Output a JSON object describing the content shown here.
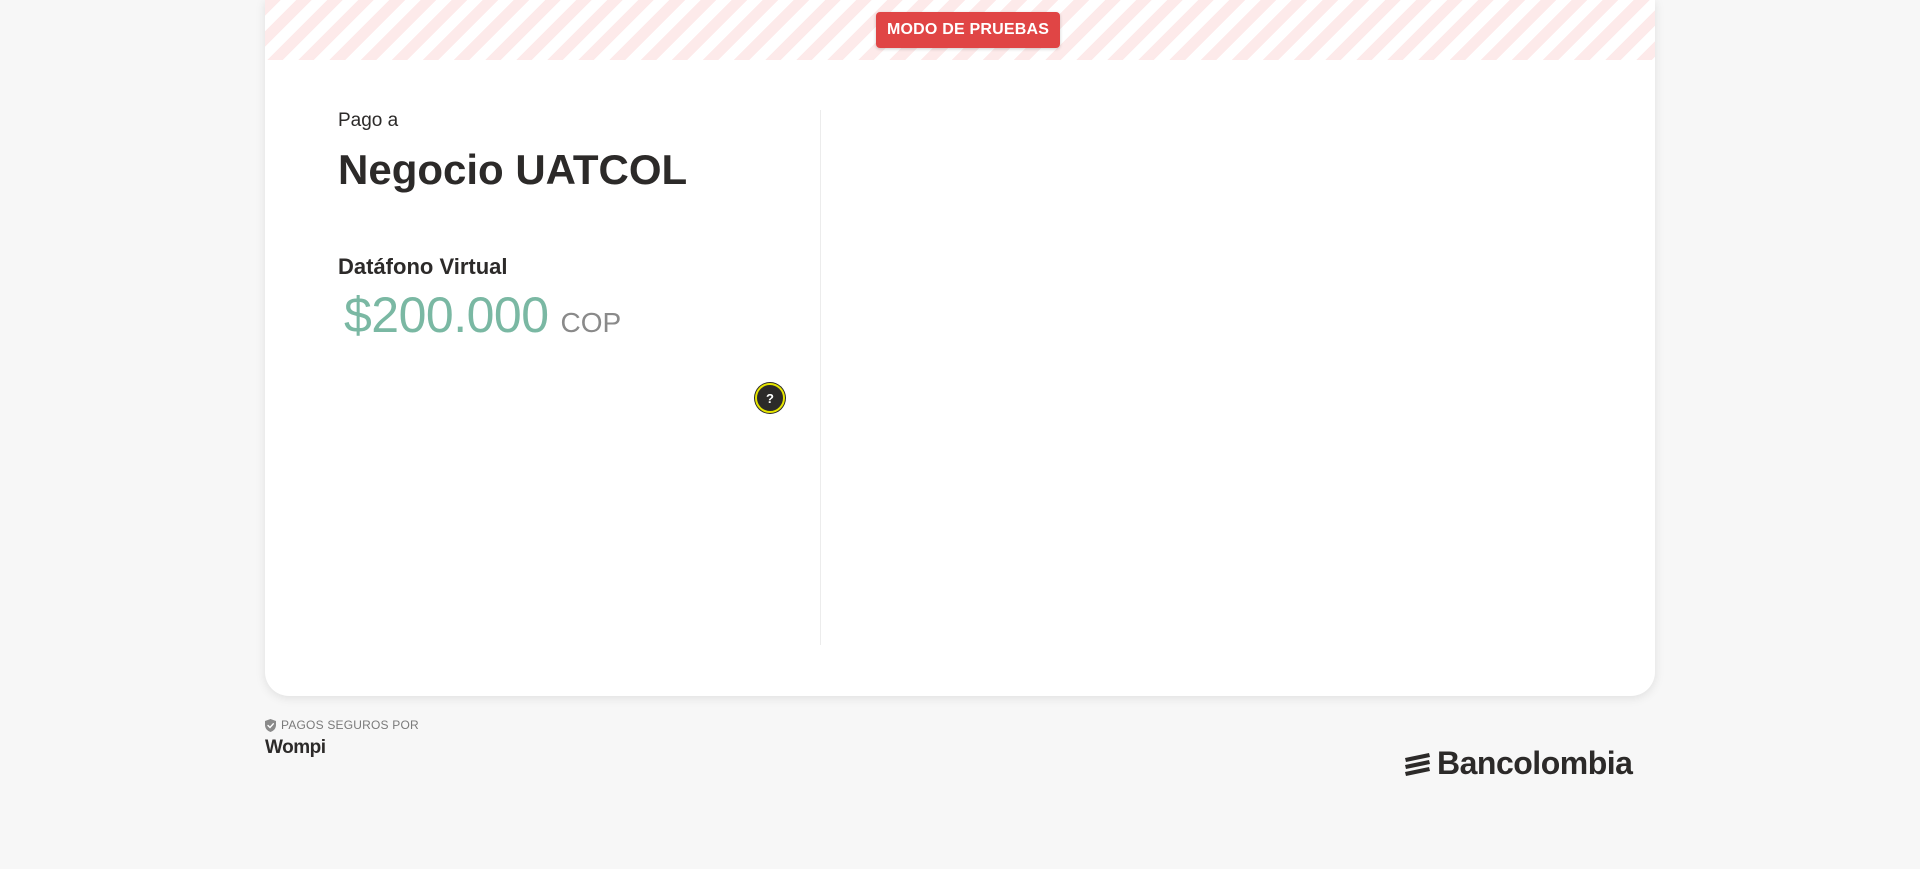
{
  "banner": {
    "test_mode_label": "MODO DE PRUEBAS"
  },
  "checkout": {
    "pay_to_label": "Pago a",
    "merchant_name": "Negocio UATCOL",
    "product_name": "Datáfono Virtual",
    "amount": "$200.000",
    "currency": "COP",
    "help_label": "?"
  },
  "footer": {
    "secure_label": "PAGOS SEGUROS POR",
    "wompi_logo": "Wompi",
    "bank_logo": "Bancolombia"
  },
  "colors": {
    "amount": "#7ab8a3",
    "badge": "#e04545",
    "text": "#2c2a29"
  }
}
